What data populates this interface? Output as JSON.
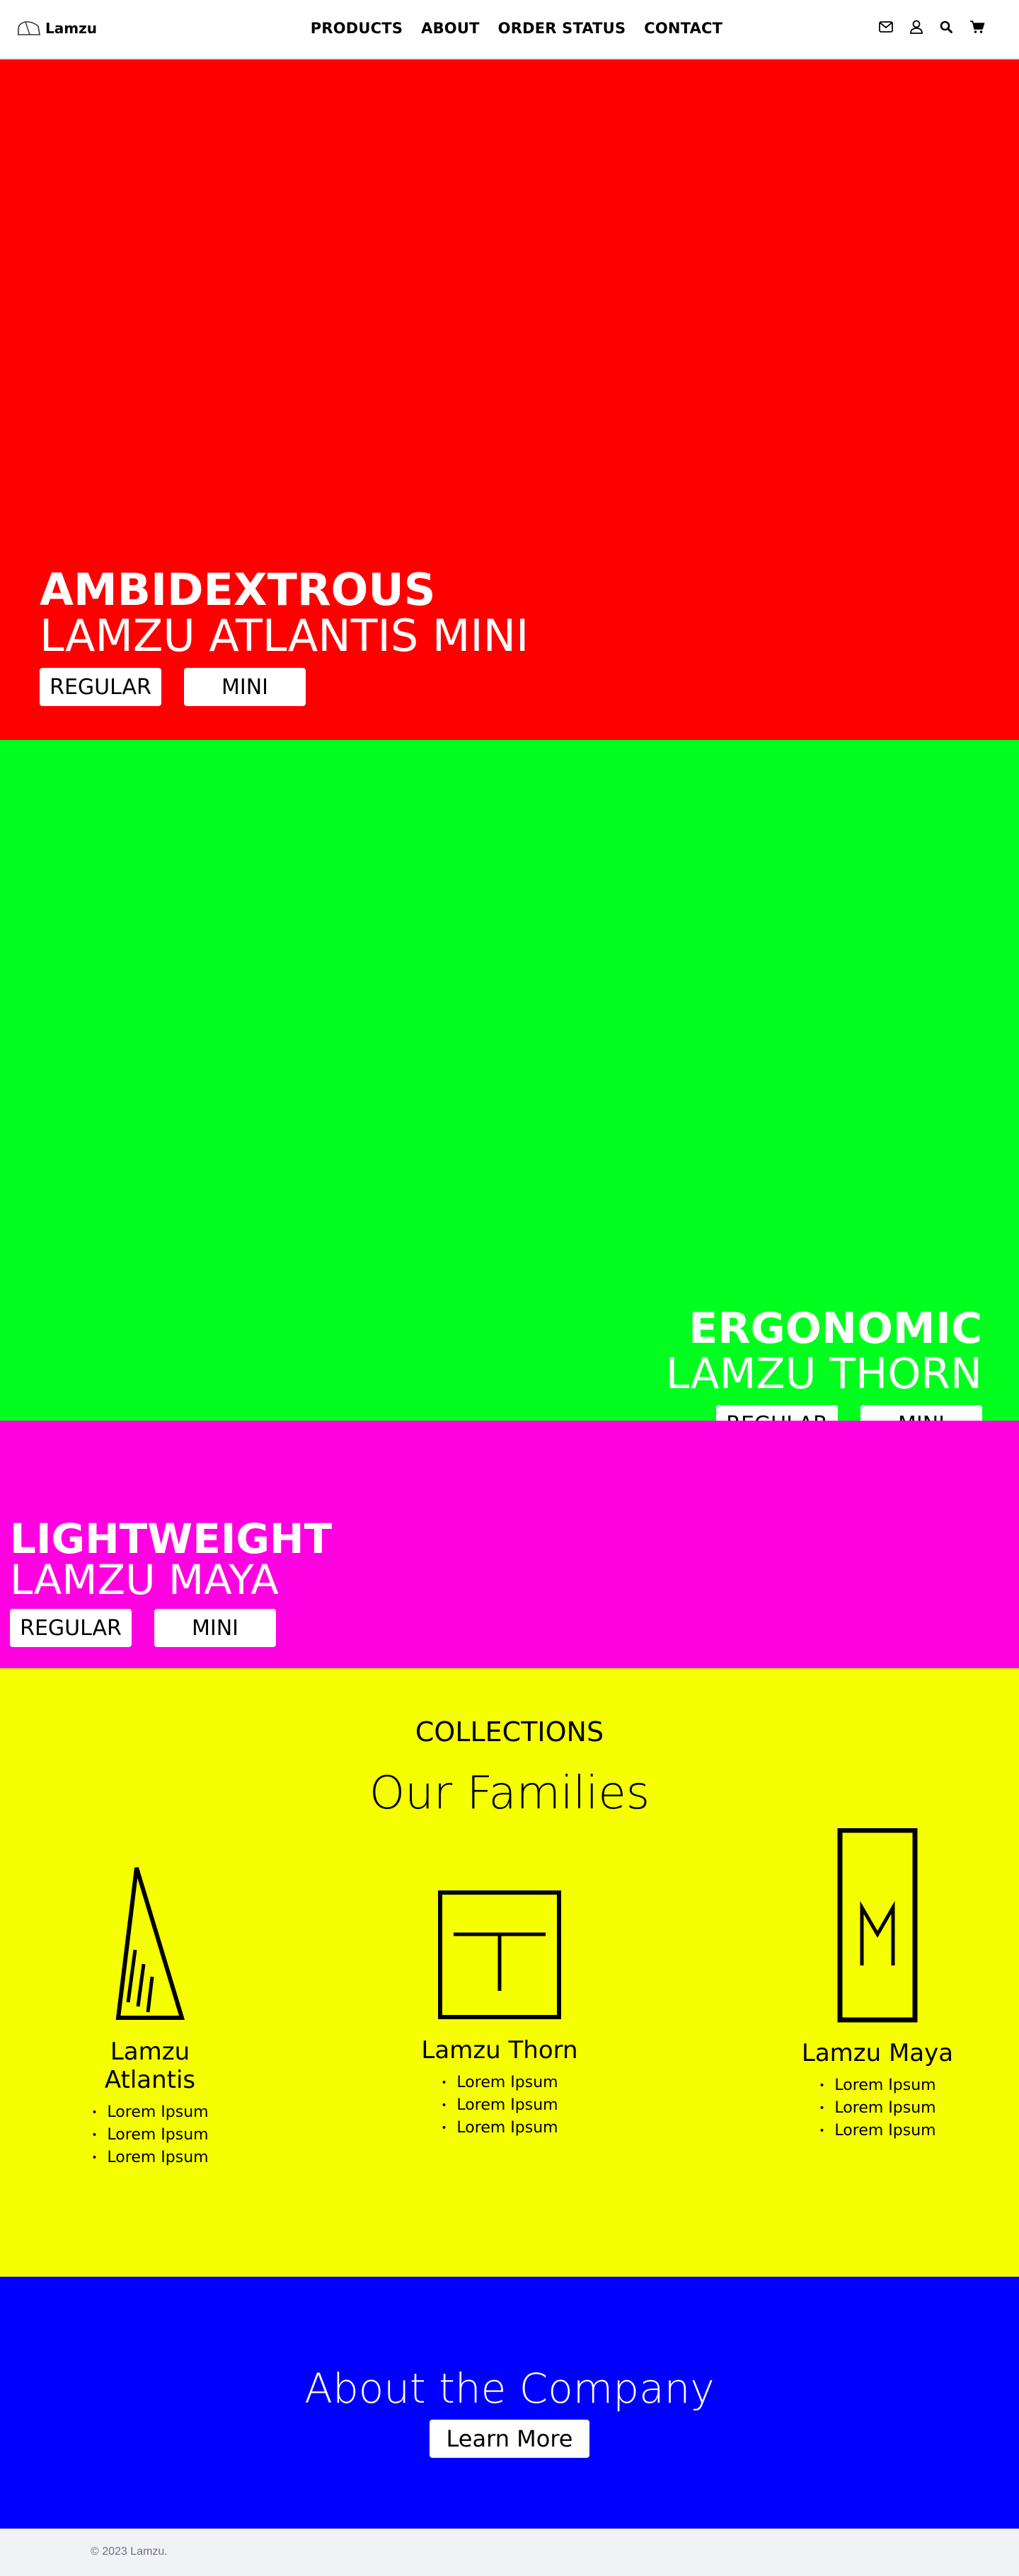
{
  "nav": {
    "brand": "Lamzu",
    "links": [
      "PRODUCTS",
      "ABOUT",
      "ORDER STATUS",
      "CONTACT"
    ],
    "icons": [
      "mail-icon",
      "user-icon",
      "search-icon",
      "cart-icon"
    ]
  },
  "heroes": [
    {
      "color": "#ff0000",
      "tagline": "AMBIDEXTROUS",
      "product": "LAMZU ATLANTIS MINI",
      "buttons": [
        "REGULAR",
        "MINI"
      ]
    },
    {
      "color": "#00ff1e",
      "tagline": "ERGONOMIC",
      "product": "LAMZU THORN",
      "buttons": [
        "REGULAR",
        "MINI"
      ]
    },
    {
      "color": "#ff00e1",
      "tagline": "LIGHTWEIGHT",
      "product": "LAMZU MAYA",
      "buttons": [
        "REGULAR",
        "MINI"
      ]
    }
  ],
  "collections": {
    "background": "#f6ff00",
    "kicker": "COLLECTIONS",
    "title": "Our Families",
    "families": [
      {
        "name": "Lamzu Atlantis",
        "icon": "atlantis-logo-icon",
        "items": [
          "Lorem Ipsum",
          "Lorem Ipsum",
          "Lorem Ipsum"
        ]
      },
      {
        "name": "Lamzu Thorn",
        "icon": "thorn-logo-icon",
        "items": [
          "Lorem Ipsum",
          "Lorem Ipsum",
          "Lorem Ipsum"
        ]
      },
      {
        "name": "Lamzu Maya",
        "icon": "maya-logo-icon",
        "items": [
          "Lorem Ipsum",
          "Lorem Ipsum",
          "Lorem Ipsum"
        ]
      }
    ]
  },
  "about": {
    "background": "#0000ff",
    "title": "About the Company",
    "button": "Learn More"
  },
  "footer": {
    "copyright": "© 2023 Lamzu."
  }
}
